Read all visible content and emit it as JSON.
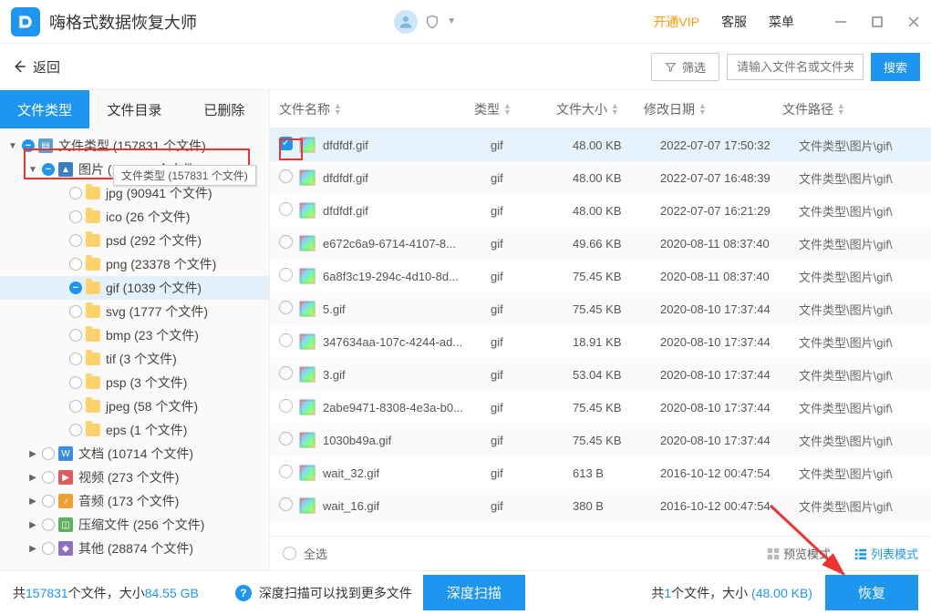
{
  "app": {
    "title": "嗨格式数据恢复大师"
  },
  "titlebar": {
    "vip": "开通VIP",
    "support": "客服",
    "menu": "菜单"
  },
  "toolbar": {
    "back": "返回",
    "filter": "筛选",
    "search_placeholder": "请输入文件名或文件夹名",
    "search": "搜索"
  },
  "tabs": {
    "type": "文件类型",
    "dir": "文件目录",
    "deleted": "已删除"
  },
  "tree": {
    "root": "文件类型 (157831 个文件)",
    "tooltip": "文件类型 (157831 个文件)",
    "pic": "图片 (117541 个文件)",
    "items": [
      "jpg (90941 个文件)",
      "ico (26 个文件)",
      "psd (292 个文件)",
      "png (23378 个文件)",
      "gif (1039 个文件)",
      "svg (1777 个文件)",
      "bmp (23 个文件)",
      "tif (3 个文件)",
      "psp (3 个文件)",
      "jpeg (58 个文件)",
      "eps (1 个文件)"
    ],
    "doc": "文档 (10714 个文件)",
    "vid": "视频 (273 个文件)",
    "aud": "音频 (173 个文件)",
    "zip": "压缩文件 (256 个文件)",
    "oth": "其他 (28874 个文件)"
  },
  "columns": {
    "name": "文件名称",
    "type": "类型",
    "size": "文件大小",
    "date": "修改日期",
    "path": "文件路径"
  },
  "rows": [
    {
      "n": "dfdfdf.gif",
      "t": "gif",
      "s": "48.00 KB",
      "d": "2022-07-07 17:50:32",
      "p": "文件类型\\图片\\gif\\",
      "chk": true
    },
    {
      "n": "dfdfdf.gif",
      "t": "gif",
      "s": "48.00 KB",
      "d": "2022-07-07 16:48:39",
      "p": "文件类型\\图片\\gif\\"
    },
    {
      "n": "dfdfdf.gif",
      "t": "gif",
      "s": "48.00 KB",
      "d": "2022-07-07 16:21:29",
      "p": "文件类型\\图片\\gif\\"
    },
    {
      "n": "e672c6a9-6714-4107-8...",
      "t": "gif",
      "s": "49.66 KB",
      "d": "2020-08-11 08:37:40",
      "p": "文件类型\\图片\\gif\\"
    },
    {
      "n": "6a8f3c19-294c-4d10-8d...",
      "t": "gif",
      "s": "75.45 KB",
      "d": "2020-08-11 08:37:40",
      "p": "文件类型\\图片\\gif\\"
    },
    {
      "n": "5.gif",
      "t": "gif",
      "s": "75.45 KB",
      "d": "2020-08-10 17:37:44",
      "p": "文件类型\\图片\\gif\\"
    },
    {
      "n": "347634aa-107c-4244-ad...",
      "t": "gif",
      "s": "18.91 KB",
      "d": "2020-08-10 17:37:44",
      "p": "文件类型\\图片\\gif\\"
    },
    {
      "n": "3.gif",
      "t": "gif",
      "s": "53.04 KB",
      "d": "2020-08-10 17:37:44",
      "p": "文件类型\\图片\\gif\\"
    },
    {
      "n": "2abe9471-8308-4e3a-b0...",
      "t": "gif",
      "s": "75.45 KB",
      "d": "2020-08-10 17:37:44",
      "p": "文件类型\\图片\\gif\\"
    },
    {
      "n": "1030b49a.gif",
      "t": "gif",
      "s": "75.45 KB",
      "d": "2020-08-10 17:37:44",
      "p": "文件类型\\图片\\gif\\"
    },
    {
      "n": "wait_32.gif",
      "t": "gif",
      "s": "613 B",
      "d": "2016-10-12 00:47:54",
      "p": "文件类型\\图片\\gif\\"
    },
    {
      "n": "wait_16.gif",
      "t": "gif",
      "s": "380 B",
      "d": "2016-10-12 00:47:54",
      "p": "文件类型\\图片\\gif\\"
    }
  ],
  "pane_footer": {
    "select_all": "全选",
    "preview": "预览模式",
    "list": "列表模式"
  },
  "status": {
    "total_prefix": "共",
    "total_count": "157831",
    "total_mid": "个文件，大小",
    "total_size": "84.55 GB",
    "tip": "深度扫描可以找到更多文件",
    "deep_scan": "深度扫描",
    "sel_prefix": "共",
    "sel_count": "1",
    "sel_mid": "个文件，大小",
    "sel_size": "(48.00 KB)",
    "recover": "恢复"
  }
}
